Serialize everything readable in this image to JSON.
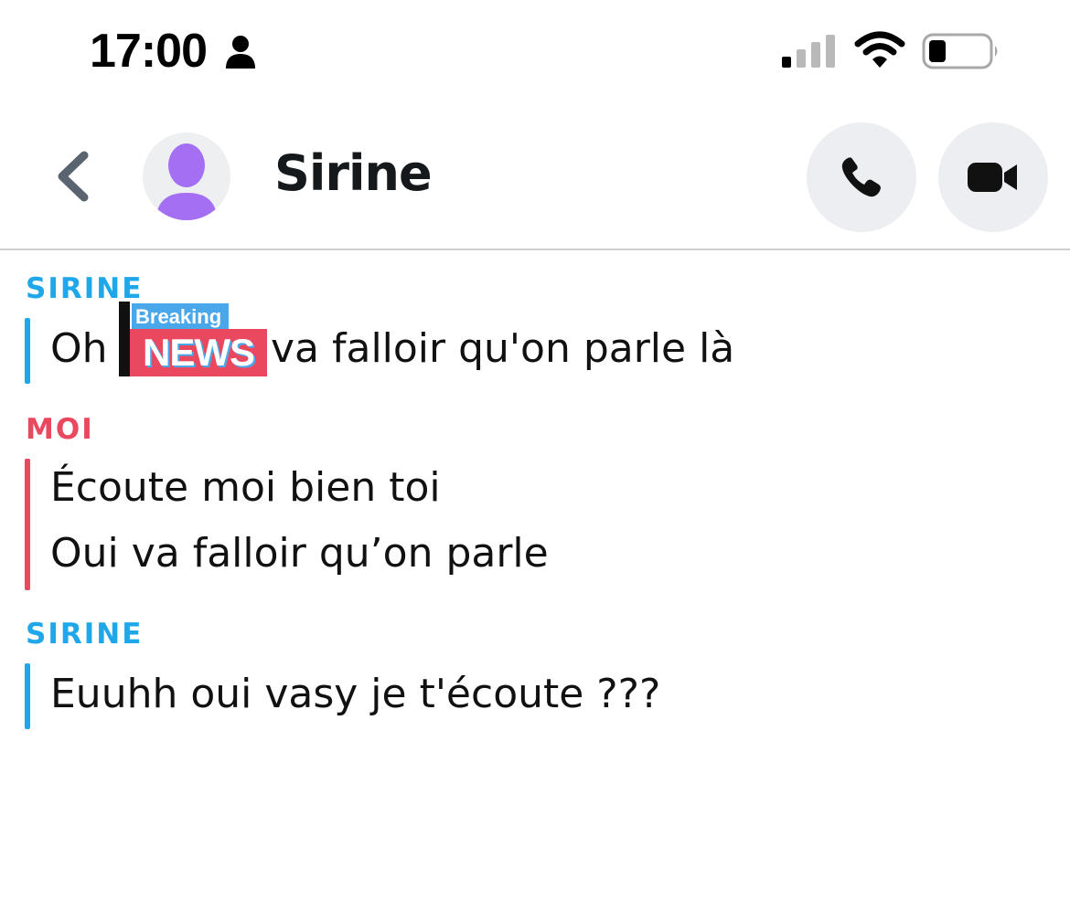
{
  "status_bar": {
    "time": "17:00",
    "icons": [
      "person-icon",
      "signal-icon",
      "wifi-icon",
      "battery-icon"
    ]
  },
  "header": {
    "back_icon": "chevron-left-icon",
    "avatar_icon": "person-silhouette-icon",
    "contact_name": "Sirine",
    "call_icon": "phone-icon",
    "video_icon": "video-camera-icon"
  },
  "colors": {
    "them": "#1fa7ea",
    "me": "#e9485f",
    "avatar": "#a46ff2",
    "button_bg": "#eceef1"
  },
  "messages": [
    {
      "sender": "SIRINE",
      "lines": [
        "Oh",
        "va falloir qu'on parle là"
      ]
    },
    {
      "sender": "MOI",
      "lines": [
        "Écoute moi bien toi",
        "Oui va falloir qu’on parle"
      ]
    },
    {
      "sender": "SIRINE",
      "lines": [
        "Euuhh oui vasy je t'écoute ???"
      ]
    }
  ],
  "sticker": {
    "top_text": "Breaking",
    "main_text": "NEWS"
  }
}
